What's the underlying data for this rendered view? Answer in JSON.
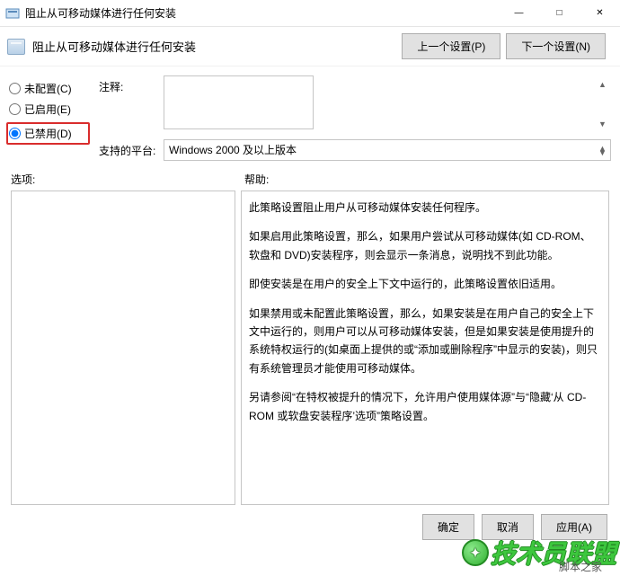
{
  "window": {
    "title": "阻止从可移动媒体进行任何安装",
    "minimize": "—",
    "maximize": "□",
    "close": "✕"
  },
  "toolbar": {
    "icon_name": "policy-editor-icon",
    "title": "阻止从可移动媒体进行任何安装",
    "prev_label": "上一个设置(P)",
    "next_label": "下一个设置(N)"
  },
  "radios": {
    "not_configured": "未配置(C)",
    "enabled": "已启用(E)",
    "disabled": "已禁用(D)",
    "selected": "disabled"
  },
  "fields": {
    "comment_label": "注释:",
    "comment_value": "",
    "platform_label": "支持的平台:",
    "platform_value": "Windows 2000 及以上版本"
  },
  "sections": {
    "options_label": "选项:",
    "help_label": "帮助:"
  },
  "help_text": {
    "p1": "此策略设置阻止用户从可移动媒体安装任何程序。",
    "p2": "如果启用此策略设置，那么，如果用户尝试从可移动媒体(如 CD-ROM、软盘和 DVD)安装程序，则会显示一条消息，说明找不到此功能。",
    "p3": "即使安装是在用户的安全上下文中运行的，此策略设置依旧适用。",
    "p4": "如果禁用或未配置此策略设置，那么，如果安装是在用户自己的安全上下文中运行的，则用户可以从可移动媒体安装，但是如果安装是使用提升的系统特权运行的(如桌面上提供的或“添加或删除程序”中显示的安装)，则只有系统管理员才能使用可移动媒体。",
    "p5": "另请参阅“在特权被提升的情况下，允许用户使用媒体源”与“隐藏‘从 CD-ROM 或软盘安装程序’选项”策略设置。"
  },
  "footer": {
    "ok": "确定",
    "cancel": "取消",
    "apply": "应用(A)"
  },
  "watermark": {
    "main": "技术员联盟",
    "sub": "脚本之家"
  }
}
